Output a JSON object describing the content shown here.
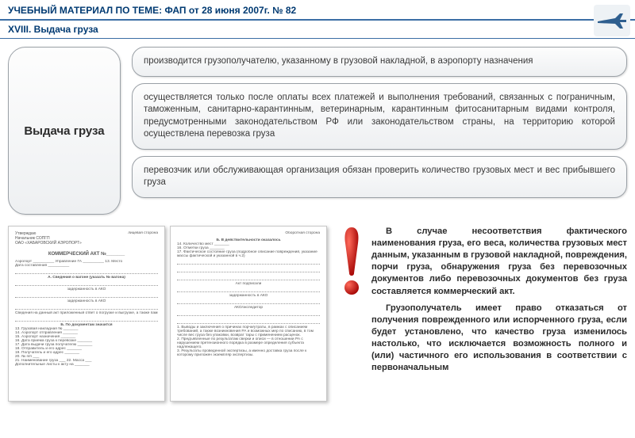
{
  "header": {
    "title": "УЧЕБНЫЙ МАТЕРИАЛ ПО ТЕМЕ: ФАП от 28 июня 2007г. № 82",
    "subtitle": "XVIII. Выдача груза"
  },
  "left_pill": "Выдача груза",
  "bullets": [
    "производится грузополучателю, указанному в грузовой накладной, в аэропорту назначения",
    "осуществляется только после оплаты всех платежей и выполнения требований, связанных с пограничным, таможенным, санитарно-карантинным, ветеринарным, карантинным фитосанитарным видами контроля, предусмотренными законодательством РФ или законодательством страны, на территорию которой осуществлена перевозка груза",
    "перевозчик или обслуживающая организация обязан проверить количество грузовых мест и вес прибывшего груза"
  ],
  "form": {
    "approve": "Утверждаю\nНачальник СОПГП\nОАО «ХАБАРОВСКИЙ АЭРОПОРТ»",
    "side_left": "лицевая сторона",
    "side_right": "Оборотная сторона",
    "doc_title": "КОММЕРЧЕСКИЙ АКТ №_______",
    "airport": "Аэропорт __________ Управление ГА __________ 13. Место",
    "date": "Дата составления __________",
    "line_a": "А. Сведения о вагоне (указать № вагона)",
    "sub_a1": "задержанность в АКО",
    "sub_a2": "задержанность в АКО",
    "note_a": "Сведения на данный акт приложенный ответ о погрузке и выгрузке, а также памятка составляются при наличии груза",
    "section_b": "Б. По документам значится",
    "b1": "13. Грузовая накладная № _______",
    "b2": "14. Аэропорт отправления _______",
    "b3": "15. Аэропорт назначения _______",
    "b4": "16. Дата приема груза к перевозке _______",
    "b5": "17. Дата выдачи груза получателю _______",
    "b6": "18. Отправитель и его адрес _______",
    "b7": "19. Получатель и его адрес _______",
    "b8": "20. № п/п ___",
    "b9": "21. Наименование груза ___ 22. Масса ___",
    "b10": "Дополнительные листы к акту на _______",
    "r_head": "Б. В действительности оказалось",
    "r1": "14. Количество мест _______",
    "r2": "16. Отметки груза _______",
    "r3": "17. Фактическое состояние груза (подробное описание повреждений, указание массы фактической и указанной в ч.2)",
    "r_sub": "Акт подписали",
    "r4": "задержанность в АКО",
    "r5": "АКО/экспедитор",
    "r_para": "1. Выводы и заключения о причинах порчи/утраты, в рамках с описанием требований, а также возникновения РА и возможных мер по списанию, в том числе вес груза без упаковки, возврат тары с применением расценок.\n2. Предъявленные по результатам сверки и описи — в отношении РА с нарушением претензионного порядка в размере определения субъекта надлежащего.\n3. Результаты проведенной экспертизы, а именно доставка груза после к которому приложен экземпляр экспертизы."
  },
  "note": {
    "p1": "В случае несоответствия фактического наименования груза, его веса, количества грузовых мест данным, указанным в грузовой накладной, повреждения, порчи груза, обнаружения груза без перевозочных документов либо перевозочных документов без груза составляется коммерческий акт.",
    "p2": "Грузополучатель имеет право отказаться от получения поврежденного или испорченного груза, если будет установлено, что качество груза изменилось настолько, что исключается возможность полного и (или) частичного его использования в соответствии с первоначальным"
  }
}
